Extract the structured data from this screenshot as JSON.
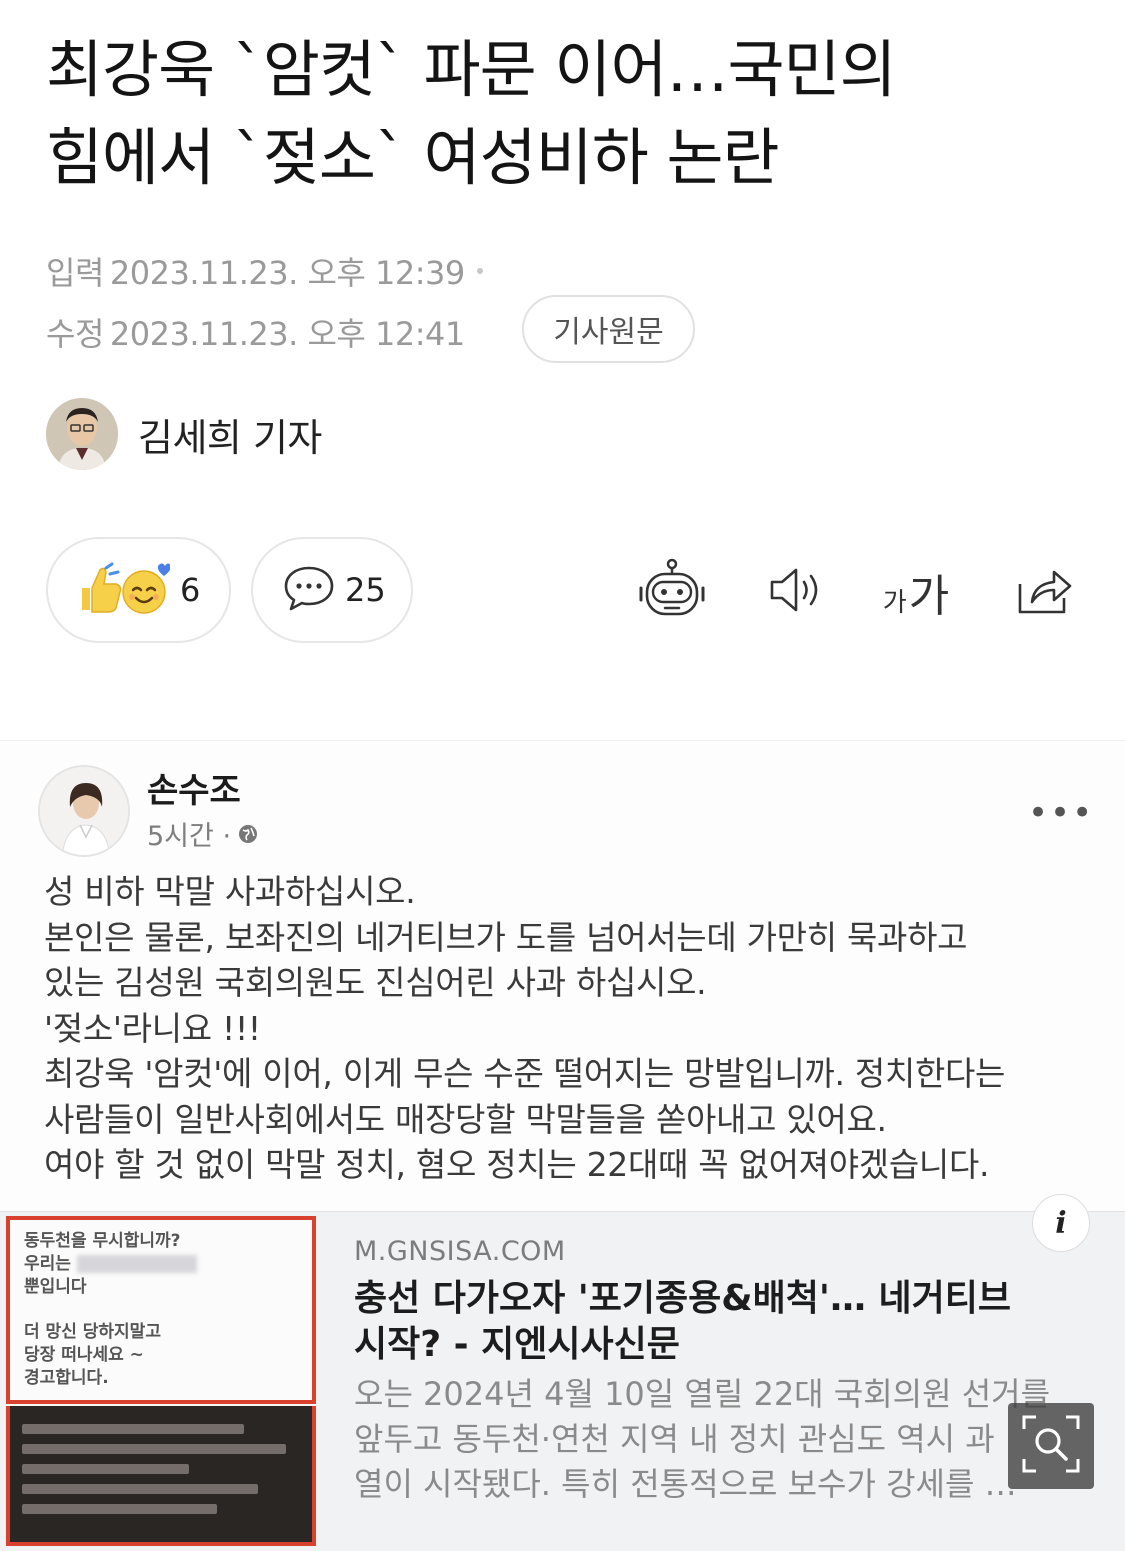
{
  "article": {
    "headline_line1": "최강욱 `암컷` 파문 이어…국민의",
    "headline_line2": "힘에서 `젖소` 여성비하 논란",
    "input_label": "입력",
    "input_time": "2023.11.23. 오후 12:39",
    "modified_label": "수정",
    "modified_time": "2023.11.23. 오후 12:41",
    "original_button": "기사원문",
    "author": "김세희 기자"
  },
  "actions": {
    "reaction_count": "6",
    "comment_count": "25",
    "font_small": "가",
    "font_big": "가",
    "icons": [
      "reaction-emoji-icon",
      "comment-icon",
      "ai-robot-icon",
      "speaker-icon",
      "font-size-icon",
      "share-icon"
    ]
  },
  "post": {
    "name": "손수조",
    "time": "5시간 ·",
    "more": "•••",
    "lines": [
      "성 비하 막말 사과하십시오.",
      "본인은 물론, 보좌진의 네거티브가 도를 넘어서는데 가만히 묵과하고",
      "있는 김성원 국회의원도 진심어린 사과 하십시오.",
      "'젖소'라니요 !!!",
      "최강욱 '암컷'에 이어, 이게 무슨 수준 떨어지는 망발입니까. 정치한다는",
      "사람들이 일반사회에서도 매장당할 막말들을 쏟아내고 있어요.",
      "여야 할 것 없이 막말 정치, 혐오 정치는 22대때 꼭 없어져야겠습니다."
    ],
    "link": {
      "domain": "M.GNSISA.COM",
      "title_line1": "충선 다가오자 '포기종용&배척'… 네거티브",
      "title_line2": "시작? - 지엔시사신문",
      "desc_line1": "오는 2024년 4월 10일 열릴 22대 국회의원 선거를",
      "desc_line2": "앞두고 동두천·연천 지역 내 정치 관심도 역시 과",
      "desc_line3": "열이 시작됐다. 특히 전통적으로 보수가 강세를 …",
      "info": "i"
    },
    "thumbnail": {
      "line1": "동두천을 무시합니까?",
      "line2": "우리는",
      "line3": "뿐입니다",
      "line4": "더 망신 당하지말고",
      "line5": "당장 떠나세요 ~",
      "line6": "경고합니다."
    }
  },
  "colors": {
    "accent_red": "#d8412e",
    "meta_gray": "#9a9a9a",
    "card_bg": "#f1f2f4"
  }
}
